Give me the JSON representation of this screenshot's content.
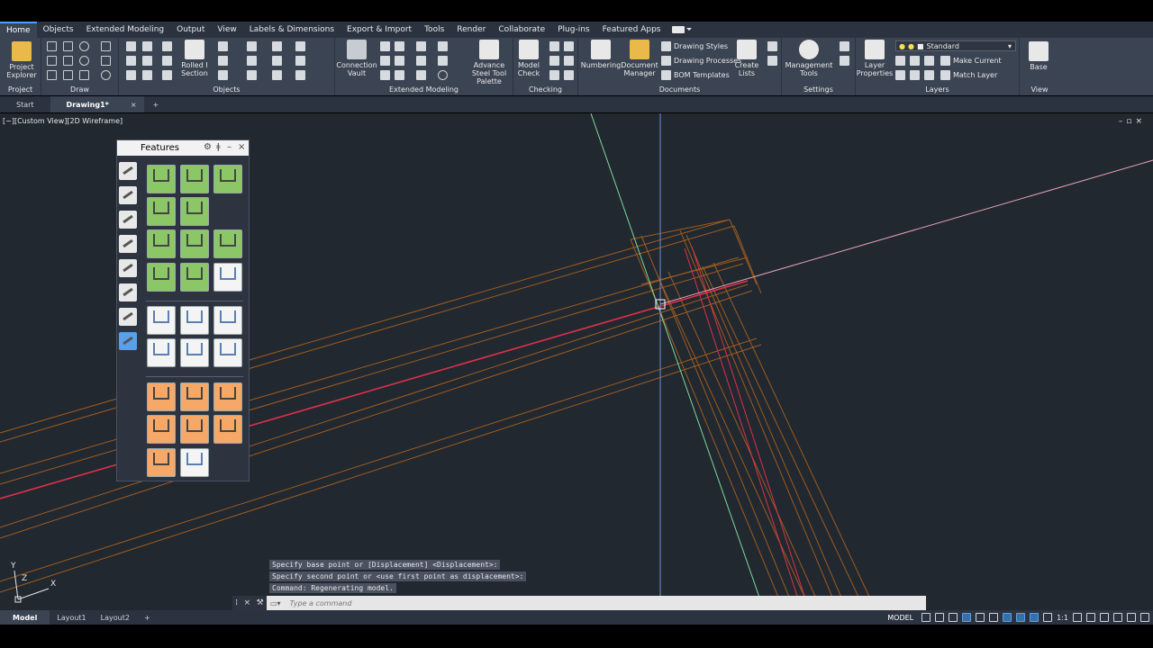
{
  "ribbon_tabs": [
    "Home",
    "Objects",
    "Extended Modeling",
    "Output",
    "View",
    "Labels & Dimensions",
    "Export & Import",
    "Tools",
    "Render",
    "Collaborate",
    "Plug-ins",
    "Featured Apps"
  ],
  "ribbon": {
    "project_explorer": "Project Explorer",
    "rolled_section": "Rolled I Section",
    "connection_vault": "Connection Vault",
    "advance_steel_tool_palette": "Advance Steel Tool Palette",
    "model_check": "Model Check",
    "numbering": "Numbering",
    "document_manager": "Document Manager",
    "drawing_styles": "Drawing Styles",
    "drawing_processes": "Drawing Processes",
    "bom_templates": "BOM Templates",
    "create_lists": "Create Lists",
    "management_tools": "Management Tools",
    "layer_properties": "Layer Properties",
    "layer_dropdown": "Standard",
    "make_current": "Make Current",
    "match_layer": "Match Layer",
    "base": "Base",
    "panels": {
      "project": "Project",
      "draw": "Draw",
      "objects": "Objects",
      "extended_modeling": "Extended Modeling",
      "checking": "Checking",
      "documents": "Documents",
      "settings": "Settings",
      "layers": "Layers",
      "view": "View"
    }
  },
  "doc_tabs": {
    "start": "Start",
    "drawing": "Drawing1*",
    "close": "×",
    "add": "+"
  },
  "viewport": {
    "label": "[−][Custom View][2D Wireframe]",
    "controls": "–▫×"
  },
  "features_palette": {
    "title": "Features"
  },
  "command": {
    "history": [
      "Specify base point or [Displacement] <Displacement>:",
      "Specify second point or <use first point as displacement>:",
      "Command:  Regenerating model."
    ],
    "placeholder": "Type a command"
  },
  "ucs": {
    "y": "Y",
    "z": "Z",
    "x": "X"
  },
  "status": {
    "layouts": [
      "Model",
      "Layout1",
      "Layout2"
    ],
    "add": "+",
    "model_label": "MODEL",
    "scale": "1:1"
  },
  "colors": {
    "viewport_bg": "#212830",
    "ribbon_bg": "#3b4453",
    "beam": "#b5651d",
    "red_line": "#e0304a",
    "green_axis": "#7ed99a",
    "blue_axis": "#6f8fd6",
    "pink_line": "#e7a3b6"
  }
}
